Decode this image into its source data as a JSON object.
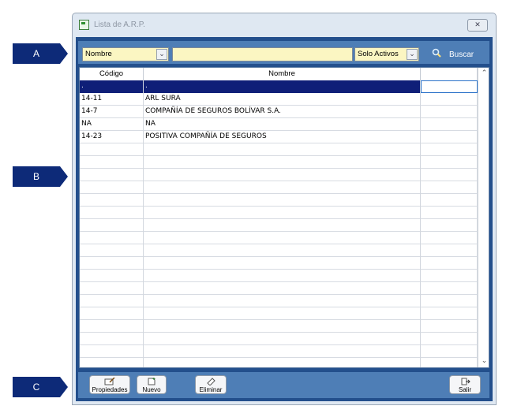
{
  "callouts": [
    "A",
    "B",
    "C"
  ],
  "window": {
    "title": "Lista de A.R.P.",
    "close_label": "✕"
  },
  "toolbar": {
    "field_combo": "Nombre",
    "filter_combo": "Solo Activos",
    "search_text": "",
    "search_button": "Buscar"
  },
  "grid": {
    "columns": [
      "Código",
      "Nombre",
      ""
    ],
    "rows": [
      {
        "codigo": ".",
        "nombre": "."
      },
      {
        "codigo": "14-11",
        "nombre": "ARL SURA"
      },
      {
        "codigo": "14-7",
        "nombre": "COMPAÑÍA DE SEGUROS BOLÍVAR S.A."
      },
      {
        "codigo": "NA",
        "nombre": "NA"
      },
      {
        "codigo": "14-23",
        "nombre": "POSITIVA COMPAÑÍA DE SEGUROS"
      }
    ],
    "scroll_up": "⌃",
    "scroll_down": "⌄"
  },
  "buttons": {
    "properties": "Propiedades",
    "new": "Nuevo",
    "delete": "Eliminar",
    "exit": "Salir"
  }
}
